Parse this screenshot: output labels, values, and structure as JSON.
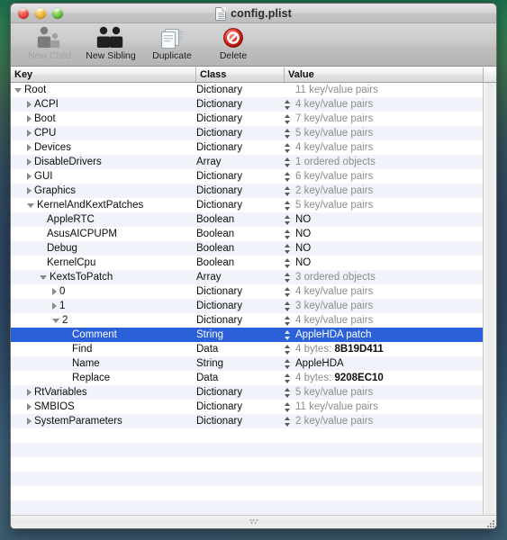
{
  "window": {
    "title": "config.plist",
    "doc_icon": "document-icon",
    "traffic_lights": [
      {
        "name": "close-button",
        "color": "#e0392f"
      },
      {
        "name": "minimize-button",
        "color": "#e8a418"
      },
      {
        "name": "zoom-button",
        "color": "#55b231"
      }
    ]
  },
  "toolbar": {
    "items": [
      {
        "label": "New Child",
        "icon": "new-child-icon",
        "enabled": false
      },
      {
        "label": "New Sibling",
        "icon": "new-sibling-icon",
        "enabled": true
      },
      {
        "label": "Duplicate",
        "icon": "duplicate-icon",
        "enabled": true
      },
      {
        "label": "Delete",
        "icon": "delete-icon",
        "enabled": true
      }
    ]
  },
  "table": {
    "columns": [
      "Key",
      "Class",
      "Value"
    ],
    "selection_color": "#2b60d8",
    "rows": [
      {
        "key": "Root",
        "indent": 0,
        "disclosure": "open",
        "class": "Dictionary",
        "value": "11 key/value pairs",
        "value_style": "muted",
        "stepper": false,
        "selected": false
      },
      {
        "key": "ACPI",
        "indent": 1,
        "disclosure": "closed",
        "class": "Dictionary",
        "value": "4 key/value pairs",
        "value_style": "muted",
        "stepper": true,
        "selected": false
      },
      {
        "key": "Boot",
        "indent": 1,
        "disclosure": "closed",
        "class": "Dictionary",
        "value": "7 key/value pairs",
        "value_style": "muted",
        "stepper": true,
        "selected": false
      },
      {
        "key": "CPU",
        "indent": 1,
        "disclosure": "closed",
        "class": "Dictionary",
        "value": "5 key/value pairs",
        "value_style": "muted",
        "stepper": true,
        "selected": false
      },
      {
        "key": "Devices",
        "indent": 1,
        "disclosure": "closed",
        "class": "Dictionary",
        "value": "4 key/value pairs",
        "value_style": "muted",
        "stepper": true,
        "selected": false
      },
      {
        "key": "DisableDrivers",
        "indent": 1,
        "disclosure": "closed",
        "class": "Array",
        "value": "1 ordered objects",
        "value_style": "muted",
        "stepper": true,
        "selected": false
      },
      {
        "key": "GUI",
        "indent": 1,
        "disclosure": "closed",
        "class": "Dictionary",
        "value": "6 key/value pairs",
        "value_style": "muted",
        "stepper": true,
        "selected": false
      },
      {
        "key": "Graphics",
        "indent": 1,
        "disclosure": "closed",
        "class": "Dictionary",
        "value": "2 key/value pairs",
        "value_style": "muted",
        "stepper": true,
        "selected": false
      },
      {
        "key": "KernelAndKextPatches",
        "indent": 1,
        "disclosure": "open",
        "class": "Dictionary",
        "value": "5 key/value pairs",
        "value_style": "muted",
        "stepper": true,
        "selected": false
      },
      {
        "key": "AppleRTC",
        "indent": 2,
        "disclosure": "none",
        "class": "Boolean",
        "value": "NO",
        "value_style": "bold",
        "stepper": true,
        "popup": true,
        "selected": false
      },
      {
        "key": "AsusAICPUPM",
        "indent": 2,
        "disclosure": "none",
        "class": "Boolean",
        "value": "NO",
        "value_style": "bold",
        "stepper": true,
        "popup": true,
        "selected": false
      },
      {
        "key": "Debug",
        "indent": 2,
        "disclosure": "none",
        "class": "Boolean",
        "value": "NO",
        "value_style": "bold",
        "stepper": true,
        "popup": true,
        "selected": false
      },
      {
        "key": "KernelCpu",
        "indent": 2,
        "disclosure": "none",
        "class": "Boolean",
        "value": "NO",
        "value_style": "bold",
        "stepper": true,
        "popup": true,
        "selected": false
      },
      {
        "key": "KextsToPatch",
        "indent": 2,
        "disclosure": "open",
        "class": "Array",
        "value": "3 ordered objects",
        "value_style": "muted",
        "stepper": true,
        "selected": false
      },
      {
        "key": "0",
        "indent": 3,
        "disclosure": "closed",
        "class": "Dictionary",
        "value": "4 key/value pairs",
        "value_style": "muted",
        "stepper": true,
        "selected": false
      },
      {
        "key": "1",
        "indent": 3,
        "disclosure": "closed",
        "class": "Dictionary",
        "value": "3 key/value pairs",
        "value_style": "muted",
        "stepper": true,
        "selected": false
      },
      {
        "key": "2",
        "indent": 3,
        "disclosure": "open",
        "class": "Dictionary",
        "value": "4 key/value pairs",
        "value_style": "muted",
        "stepper": true,
        "selected": false
      },
      {
        "key": "Comment",
        "indent": 4,
        "disclosure": "none",
        "class": "String",
        "value": "AppleHDA patch",
        "value_style": "plain",
        "stepper": true,
        "selected": true
      },
      {
        "key": "Find",
        "indent": 4,
        "disclosure": "none",
        "class": "Data",
        "value": "4 bytes: ",
        "value_bold": "8B19D411",
        "value_style": "muted",
        "stepper": true,
        "selected": false
      },
      {
        "key": "Name",
        "indent": 4,
        "disclosure": "none",
        "class": "String",
        "value": "AppleHDA",
        "value_style": "plain",
        "stepper": true,
        "selected": false
      },
      {
        "key": "Replace",
        "indent": 4,
        "disclosure": "none",
        "class": "Data",
        "value": "4 bytes: ",
        "value_bold": "9208EC10",
        "value_style": "muted",
        "stepper": true,
        "selected": false
      },
      {
        "key": "RtVariables",
        "indent": 1,
        "disclosure": "closed",
        "class": "Dictionary",
        "value": "5 key/value pairs",
        "value_style": "muted",
        "stepper": true,
        "selected": false
      },
      {
        "key": "SMBIOS",
        "indent": 1,
        "disclosure": "closed",
        "class": "Dictionary",
        "value": "11 key/value pairs",
        "value_style": "muted",
        "stepper": true,
        "selected": false
      },
      {
        "key": "SystemParameters",
        "indent": 1,
        "disclosure": "closed",
        "class": "Dictionary",
        "value": "2 key/value pairs",
        "value_style": "muted",
        "stepper": true,
        "selected": false
      }
    ],
    "empty_row_count": 7
  },
  "scrollbars": {
    "vertical": "vertical-scrollbar",
    "horizontal": "horizontal-scrollbar"
  }
}
